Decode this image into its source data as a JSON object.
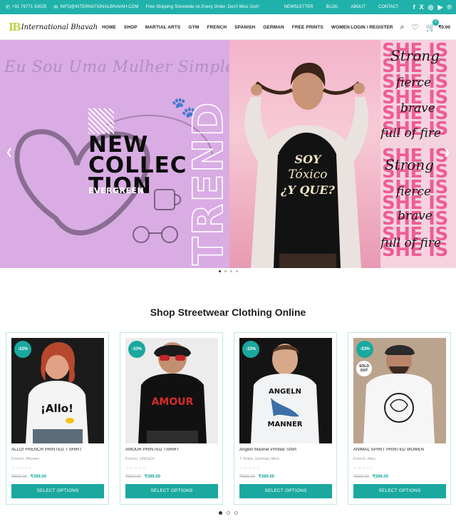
{
  "topbar": {
    "phone": "+91 79771 50025",
    "email": "INFO@INTERNATIONALBHAVAH.COM",
    "promo": "Free Shipping Storewide on Every Order, Don't Miss Out!!",
    "links": [
      "NEWSLETTER",
      "BLOG",
      "ABOUT",
      "CONTACT"
    ],
    "social": [
      "facebook-icon",
      "x-icon",
      "instagram-icon",
      "youtube-icon",
      "pinterest-icon"
    ]
  },
  "header": {
    "logo_mark": "IB",
    "logo_text": "International Bhavah",
    "nav": [
      "HOME",
      "SHOP",
      "MARTIAL ARTS",
      "GYM",
      "FRENCH",
      "SPANISH",
      "GERMAN",
      "FREE PRINTS",
      "WOMEN"
    ],
    "login": "LOGIN / REGISTER",
    "cart_count": "0",
    "cart_total": "₹0.00"
  },
  "hero": {
    "script_text": "Eu Sou Uma Mulher Simples",
    "headline_lines": [
      "NEW",
      "COLLEC",
      "TION"
    ],
    "sub": "EVERGREEN",
    "vertical_word": "TREND",
    "shirt_lines": [
      "SOY",
      "Tóxico",
      "¿Y QUE?"
    ],
    "she_is": "SHE IS",
    "words": [
      "Strong",
      "fierce",
      "brave",
      "full of fire"
    ],
    "slides": 4,
    "active_slide": 1
  },
  "section": {
    "title": "Shop Streetwear Clothing Online"
  },
  "products": [
    {
      "discount": "-33%",
      "sold_out": "",
      "name": "ALLO! FRENCH PRINTED T SHIRT",
      "category": "French, Women",
      "stars": "☆☆☆☆☆",
      "old_price": "₹599.00",
      "new_price": "₹399.00",
      "button": "SELECT OPTIONS",
      "shirt_print": "¡Allo!"
    },
    {
      "discount": "-33%",
      "sold_out": "",
      "name": "AMOUR PRINTED TSHIRT",
      "category": "French, UNISEX",
      "stars": "☆☆☆☆☆",
      "old_price": "₹599.00",
      "new_price": "₹399.00",
      "button": "SELECT OPTIONS",
      "shirt_print": "AMOUR"
    },
    {
      "discount": "-33%",
      "sold_out": "",
      "name": "Angeln Manner Printed Tshirt",
      "category": "T-Shirts, German, Men",
      "stars": "☆☆☆☆☆",
      "old_price": "₹599.00",
      "new_price": "₹399.00",
      "button": "SELECT OPTIONS",
      "shirt_print_top": "ANGELN",
      "shirt_print_bottom": "MANNER"
    },
    {
      "discount": "-33%",
      "sold_out": "SOLD OUT",
      "name": "ANIMAL SPIRIT PRINTED WOMEN",
      "category": "French, Men",
      "stars": "☆☆☆☆☆",
      "old_price": "₹599.00",
      "new_price": "₹399.00",
      "button": "SELECT OPTIONS"
    }
  ],
  "carousel": {
    "pages": 3,
    "active": 1
  },
  "colors": {
    "accent": "#1aa89f",
    "topbar": "#20b2aa",
    "hero_bg": "#d9ace4",
    "pink": "#ef5c95"
  }
}
